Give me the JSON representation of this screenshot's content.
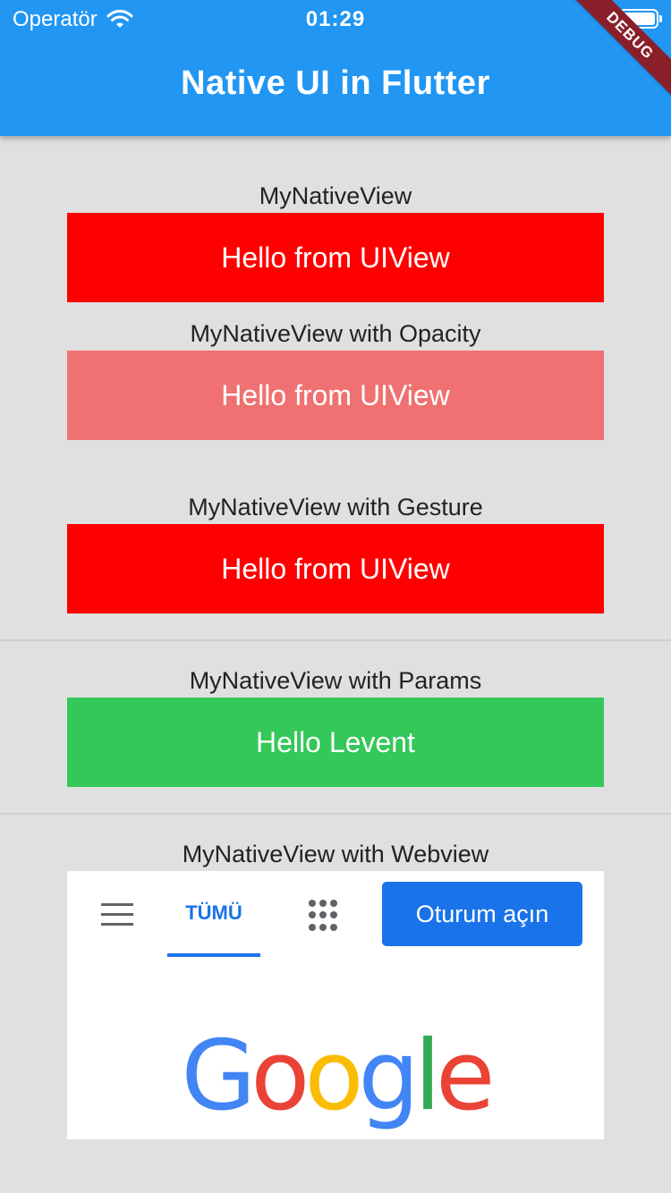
{
  "status_bar": {
    "carrier": "Operatör",
    "time": "01:29"
  },
  "app_bar": {
    "title": "Native UI in Flutter",
    "debug_banner": "DEBUG"
  },
  "sections": [
    {
      "label": "MyNativeView",
      "content": "Hello from UIView",
      "color": "#ff0000"
    },
    {
      "label": "MyNativeView with Opacity",
      "content": "Hello from UIView",
      "color": "#f07171"
    },
    {
      "label": "MyNativeView with Gesture",
      "content": "Hello from UIView",
      "color": "#ff0000"
    },
    {
      "label": "MyNativeView with Params",
      "content": "Hello Levent",
      "color": "#34c759"
    },
    {
      "label": "MyNativeView with Webview"
    }
  ],
  "webview": {
    "tab_all": "TÜMÜ",
    "signin": "Oturum açın",
    "logo_letters": [
      "G",
      "o",
      "o",
      "g",
      "l",
      "e"
    ],
    "logo_colors": [
      "#4285f4",
      "#ea4335",
      "#fbbc05",
      "#4285f4",
      "#34a853",
      "#ea4335"
    ]
  }
}
